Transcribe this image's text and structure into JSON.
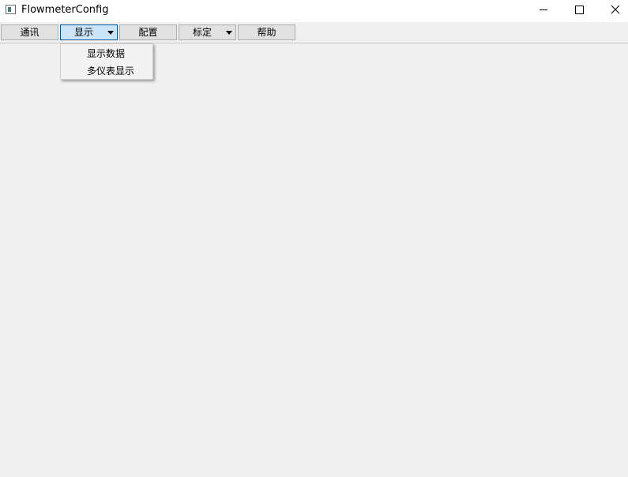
{
  "window": {
    "title": "FlowmeterConfig"
  },
  "title_bar_icons": {
    "app": "app-icon",
    "minimize": "minimize-icon",
    "maximize": "maximize-icon",
    "close": "close-icon"
  },
  "toolbar": {
    "items": [
      {
        "label": "通讯",
        "has_dropdown": false,
        "active": false
      },
      {
        "label": "显示",
        "has_dropdown": true,
        "active": true
      },
      {
        "label": "配置",
        "has_dropdown": false,
        "active": false
      },
      {
        "label": "标定",
        "has_dropdown": true,
        "active": false
      },
      {
        "label": "帮助",
        "has_dropdown": false,
        "active": false
      }
    ]
  },
  "dropdown_menu": {
    "items": [
      {
        "label": "显示数据"
      },
      {
        "label": "多仪表显示"
      }
    ]
  },
  "colors": {
    "background": "#f0f0f0",
    "titlebar": "#ffffff",
    "button_bg": "#e1e1e1",
    "button_active_bg": "#cce4f7",
    "button_active_border": "#005499"
  }
}
